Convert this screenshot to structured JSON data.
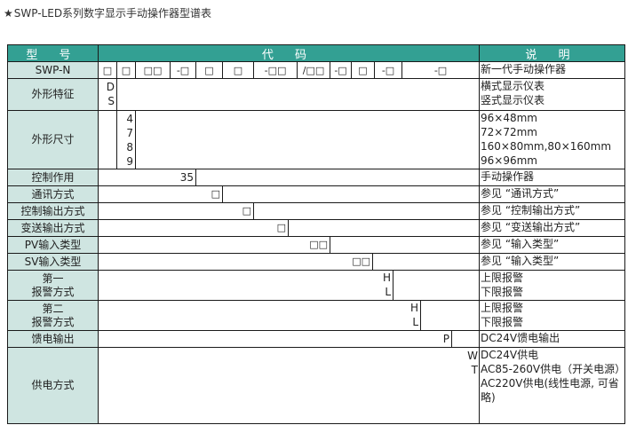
{
  "title": {
    "star": "★",
    "text": "SWP-LED系列数字显示手动操作器型谱表"
  },
  "header": {
    "model": "型 号",
    "code": "代 码",
    "desc": "说 明"
  },
  "model_row": {
    "label": "SWP-N",
    "positions": [
      "□",
      "□",
      "□□",
      "-□",
      "□",
      "□",
      "-□□",
      "/□□",
      "-□",
      "□",
      "-□",
      "-□"
    ],
    "desc": "新一代手动操作器"
  },
  "rows": [
    {
      "label": "外形特征",
      "codes": [
        "D",
        "S"
      ],
      "descs": [
        "横式显示仪表",
        "竖式显示仪表"
      ]
    },
    {
      "label": "外形尺寸",
      "codes": [
        "4",
        "7",
        "8",
        "9"
      ],
      "descs": [
        "96×48mm",
        "72×72mm",
        "160×80mm,80×160mm",
        "96×96mm"
      ]
    },
    {
      "label": "控制作用",
      "codes": [
        "35"
      ],
      "descs": [
        "手动操作器"
      ]
    },
    {
      "label": "通讯方式",
      "codes": [
        "□"
      ],
      "descs": [
        "参见 “通讯方式”"
      ]
    },
    {
      "label": "控制输出方式",
      "codes": [
        "□"
      ],
      "descs": [
        "参见 “控制输出方式”"
      ]
    },
    {
      "label": "变送输出方式",
      "codes": [
        "□"
      ],
      "descs": [
        "参见 “变送输出方式”"
      ]
    },
    {
      "label": "PV输入类型",
      "codes": [
        "□□"
      ],
      "descs": [
        "参见 “输入类型”"
      ]
    },
    {
      "label": "SV输入类型",
      "codes": [
        "□□"
      ],
      "descs": [
        "参见 “输入类型”"
      ]
    },
    {
      "label_lines": [
        "第一",
        "报警方式"
      ],
      "codes": [
        "H",
        "L"
      ],
      "descs": [
        "上限报警",
        "下限报警"
      ]
    },
    {
      "label_lines": [
        "第二",
        "报警方式"
      ],
      "codes": [
        "H",
        "L"
      ],
      "descs": [
        "上限报警",
        "下限报警"
      ]
    },
    {
      "label": "馈电输出",
      "codes": [
        "P"
      ],
      "descs": [
        "DC24V馈电输出"
      ]
    },
    {
      "label": "供电方式",
      "codes": [
        "W",
        "T"
      ],
      "descs": [
        "DC24V供电",
        "AC85-260V供电（开关电源）",
        "AC220V供电(线性电源, 可省略)"
      ]
    }
  ]
}
